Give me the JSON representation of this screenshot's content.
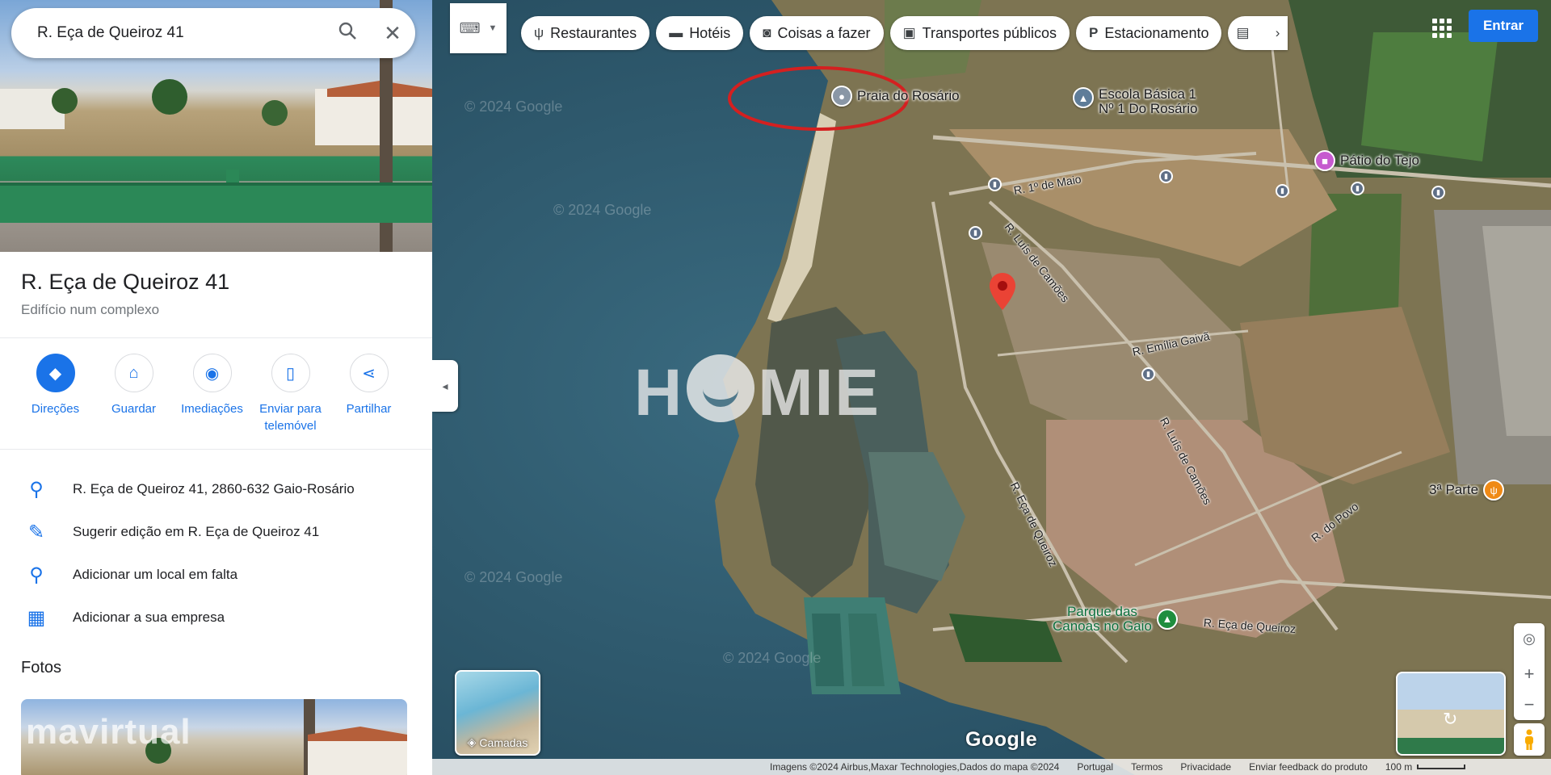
{
  "search": {
    "value": "R. Eça de Queiroz 41"
  },
  "place": {
    "title": "R. Eça de Queiroz 41",
    "subtitle": "Edifício num complexo"
  },
  "actions": [
    {
      "label": "Direções",
      "icon": "directions-icon"
    },
    {
      "label": "Guardar",
      "icon": "bookmark-icon"
    },
    {
      "label": "Imediações",
      "icon": "nearby-icon"
    },
    {
      "label": "Enviar para telemóvel",
      "icon": "send-to-phone-icon"
    },
    {
      "label": "Partilhar",
      "icon": "share-icon"
    }
  ],
  "info": [
    {
      "text": "R. Eça de Queiroz 41, 2860-632 Gaio-Rosário",
      "icon": "location-pin-icon"
    },
    {
      "text": "Sugerir edição em R. Eça de Queiroz 41",
      "icon": "pencil-icon"
    },
    {
      "text": "Adicionar um local em falta",
      "icon": "add-place-icon"
    },
    {
      "text": "Adicionar a sua empresa",
      "icon": "add-business-icon"
    }
  ],
  "photos": {
    "title": "Fotos",
    "watermark": "mavirtual"
  },
  "chips": [
    {
      "label": "Restaurantes",
      "icon": "restaurant-icon"
    },
    {
      "label": "Hotéis",
      "icon": "hotel-icon"
    },
    {
      "label": "Coisas a fazer",
      "icon": "camera-icon"
    },
    {
      "label": "Transportes públicos",
      "icon": "transit-icon"
    },
    {
      "label": "Estacionamento",
      "icon": "parking-icon"
    }
  ],
  "signin": "Entrar",
  "map": {
    "pois": {
      "praia": "Praia do Rosário",
      "escola_1": "Escola Básica 1",
      "escola_2": "Nº 1 Do Rosário",
      "patio": "Pátio do Tejo",
      "parte": "3ª Parte",
      "parque_1": "Parque das",
      "parque_2": "Canoas no Gaio"
    },
    "streets": {
      "maio": "R. 1º de Maio",
      "camoes1": "R. Luís de Camões",
      "emilia": "R. Emília Gaivã",
      "camoes2": "R. Luís de Camões",
      "eca_v": "R. Eça de Queiroz",
      "eca_h": "R. Eça de Queiroz",
      "povo": "R. do Povo"
    },
    "watermarks": {
      "g": "© 2024 Google",
      "brand": "HOMIE"
    },
    "layers_label": "Camadas",
    "logo": "Google",
    "footer": {
      "imagery": "Imagens ©2024 Airbus,Maxar Technologies,Dados do mapa ©2024",
      "country": "Portugal",
      "terms": "Termos",
      "privacy": "Privacidade",
      "feedback": "Enviar feedback do produto",
      "scale": "100 m"
    }
  },
  "colors": {
    "accent": "#1a73e8",
    "water": "#2d5a6e",
    "marker": "#ea4335",
    "highlight_circle": "#d42020"
  }
}
